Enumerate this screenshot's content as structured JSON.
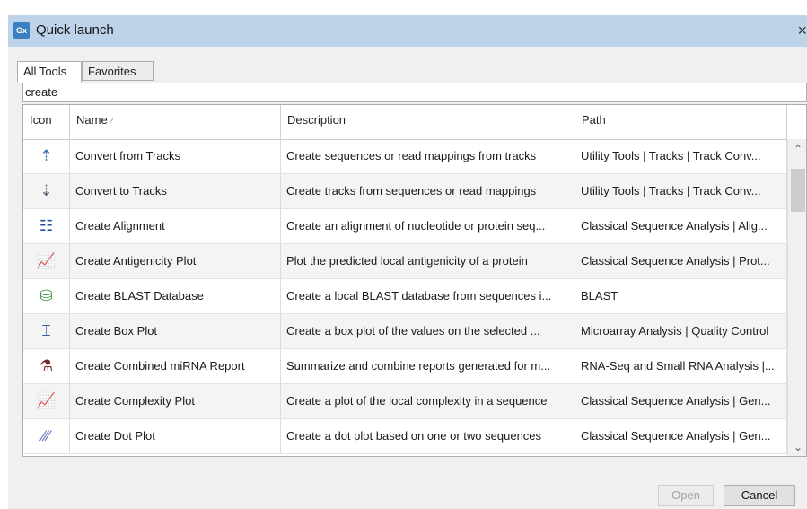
{
  "window": {
    "app_icon": "Gx",
    "title": "Quick launch",
    "close": "×"
  },
  "tabs": [
    {
      "label": "All Tools",
      "active": true
    },
    {
      "label": "Favorites",
      "active": false
    }
  ],
  "search": {
    "value": "create"
  },
  "table": {
    "headers": {
      "icon": "Icon",
      "name": "Name",
      "description": "Description",
      "path": "Path"
    },
    "sort_indicator": "⁄",
    "rows": [
      {
        "icon": "convert-from-tracks-icon",
        "glyph": "⇡",
        "color": "#3a6fb0",
        "name": "Convert from Tracks",
        "description": "Create sequences or read mappings from tracks",
        "path": "Utility Tools | Tracks | Track Conv..."
      },
      {
        "icon": "convert-to-tracks-icon",
        "glyph": "⇣",
        "color": "#5a6a7a",
        "name": "Convert to Tracks",
        "description": "Create tracks from sequences or read mappings",
        "path": "Utility Tools | Tracks | Track Conv..."
      },
      {
        "icon": "alignment-icon",
        "glyph": "☷",
        "color": "#1f4fa3",
        "name": "Create Alignment",
        "description": "Create an alignment of nucleotide or protein seq...",
        "path": "Classical Sequence Analysis | Alig..."
      },
      {
        "icon": "plot-icon",
        "glyph": "📈",
        "color": "#3a6fb0",
        "name": "Create Antigenicity Plot",
        "description": "Plot the predicted local antigenicity of a protein",
        "path": "Classical Sequence Analysis | Prot..."
      },
      {
        "icon": "blast-database-icon",
        "glyph": "⛁",
        "color": "#3f8f3f",
        "name": "Create BLAST Database",
        "description": "Create a local BLAST database from sequences i...",
        "path": "BLAST"
      },
      {
        "icon": "box-plot-icon",
        "glyph": "⌶",
        "color": "#3a5fa0",
        "name": "Create Box Plot",
        "description": "Create a box plot of the values on the selected ...",
        "path": "Microarray Analysis | Quality Control"
      },
      {
        "icon": "mirna-report-icon",
        "glyph": "⚗",
        "color": "#7a2a2a",
        "name": "Create Combined miRNA Report",
        "description": "Summarize and combine reports generated for m...",
        "path": "RNA-Seq and Small RNA Analysis |..."
      },
      {
        "icon": "plot-icon",
        "glyph": "📈",
        "color": "#3a6fb0",
        "name": "Create Complexity Plot",
        "description": "Create a plot of the local complexity in a sequence",
        "path": "Classical Sequence Analysis | Gen..."
      },
      {
        "icon": "dot-plot-icon",
        "glyph": "⁄⁄⁄",
        "color": "#5a6fc0",
        "name": "Create Dot Plot",
        "description": "Create a dot plot based on one or two sequences",
        "path": "Classical Sequence Analysis | Gen..."
      }
    ]
  },
  "scrollbar": {
    "up": "⌃",
    "down": "⌄"
  },
  "buttons": {
    "open": "Open",
    "cancel": "Cancel"
  }
}
